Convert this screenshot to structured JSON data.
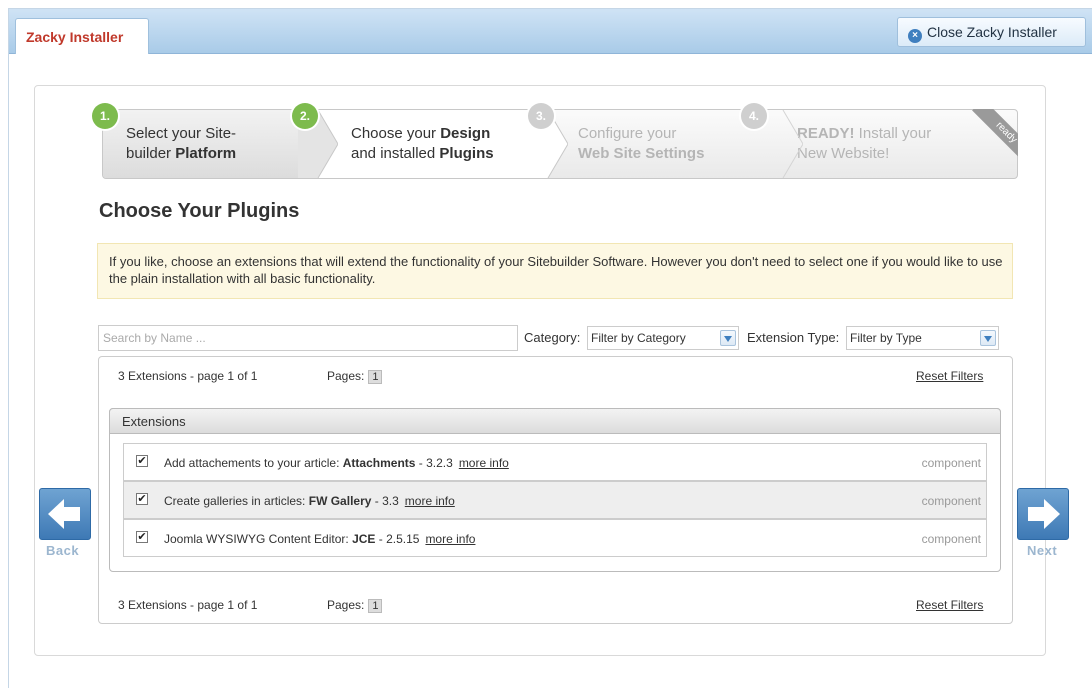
{
  "tab": {
    "label": "Zacky Installer"
  },
  "close_button": {
    "label": "Close Zacky Installer"
  },
  "steps": [
    {
      "number": "1.",
      "line1": "Select your Site-",
      "line2_plain": "builder ",
      "line2_bold": "Platform",
      "line1_bold": ""
    },
    {
      "number": "2.",
      "line1": "Choose your ",
      "line1_bold": "Design",
      "line2_plain": "and installed ",
      "line2_bold": "Plugins"
    },
    {
      "number": "3.",
      "line1": "Configure your",
      "line1_bold": "",
      "line2_plain": "",
      "line2_bold": "Web Site Settings"
    },
    {
      "number": "4.",
      "line1": " Install your",
      "line1_bold": "READY!",
      "line2_plain": "New Website!",
      "line2_bold": ""
    }
  ],
  "ribbon": "ready",
  "heading": "Choose Your Plugins",
  "notice": "If you like, choose an extensions that will extend the functionality of your Sitebuilder Software. However you don't need to select one if you would like to use the plain installation with all basic functionality.",
  "filters": {
    "search_placeholder": "Search by Name ...",
    "category_label": "Category:",
    "category_value": "Filter by Category",
    "type_label": "Extension Type:",
    "type_value": "Filter by Type"
  },
  "pager": {
    "summary": "3 Extensions - page 1 of 1",
    "pages_label": "Pages:",
    "page": "1",
    "reset": "Reset Filters"
  },
  "extensions": {
    "header": "Extensions",
    "rows": [
      {
        "checked": true,
        "prefix": "Add attachements to your article: ",
        "name": "Attachments",
        "version": " - 3.2.3",
        "more": "more info",
        "type": "component"
      },
      {
        "checked": true,
        "prefix": "Create galleries in articles: ",
        "name": "FW Gallery",
        "version": " - 3.3",
        "more": "more info",
        "type": "component"
      },
      {
        "checked": true,
        "prefix": "Joomla WYSIWYG Content Editor: ",
        "name": "JCE",
        "version": " - 2.5.15",
        "more": "more info",
        "type": "component"
      }
    ]
  },
  "nav": {
    "back": "Back",
    "next": "Next"
  }
}
